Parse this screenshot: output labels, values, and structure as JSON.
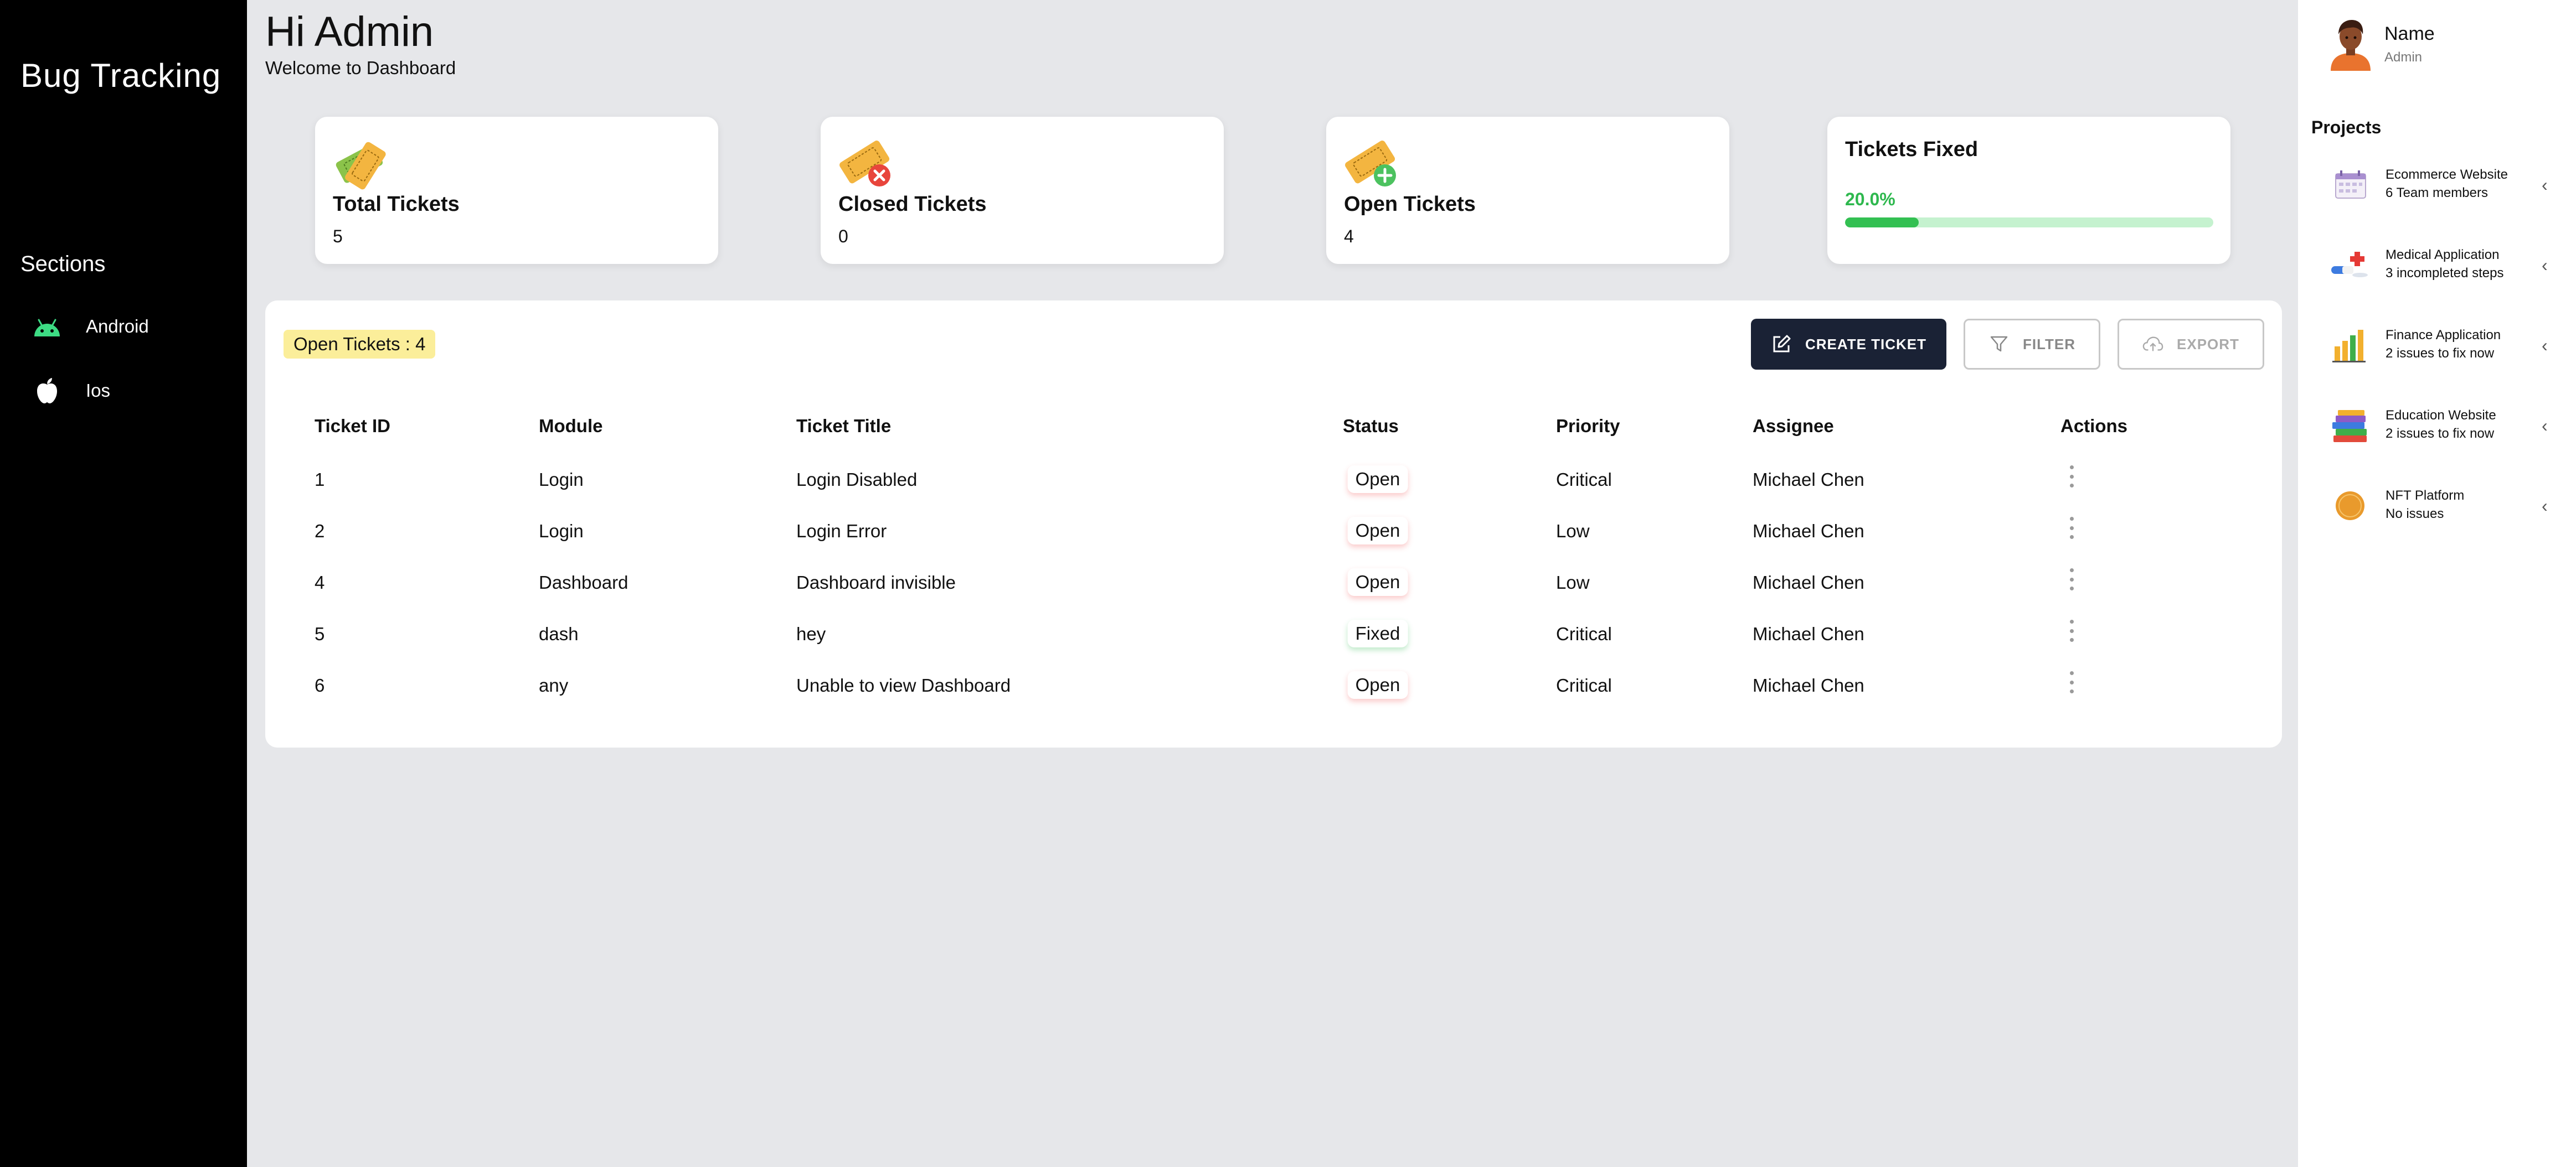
{
  "sidebar": {
    "brand": "Bug Tracking",
    "sections_heading": "Sections",
    "items": [
      {
        "label": "Android",
        "icon": "android-icon",
        "icon_color": "#3ddc84"
      },
      {
        "label": "Ios",
        "icon": "apple-icon",
        "icon_color": "#ffffff"
      }
    ]
  },
  "header": {
    "greeting": "Hi Admin",
    "subtitle": "Welcome to Dashboard"
  },
  "stats": {
    "total": {
      "label": "Total Tickets",
      "value": "5",
      "icon": "ticket-icon"
    },
    "closed": {
      "label": "Closed Tickets",
      "value": "0",
      "icon": "ticket-closed-icon"
    },
    "open": {
      "label": "Open Tickets",
      "value": "4",
      "icon": "ticket-open-icon"
    },
    "fixed": {
      "label": "Tickets Fixed",
      "percent_text": "20.0%",
      "progress": 0.2,
      "color": "#33c052"
    }
  },
  "tickets": {
    "badge": "Open Tickets : 4",
    "buttons": {
      "create": "CREATE TICKET",
      "filter": "FILTER",
      "export": "EXPORT"
    },
    "columns": [
      "Ticket ID",
      "Module",
      "Ticket Title",
      "Status",
      "Priority",
      "Assignee",
      "Actions"
    ],
    "rows": [
      {
        "id": "1",
        "module": "Login",
        "title": "Login Disabled",
        "status": "Open",
        "priority": "Critical",
        "assignee": "Michael Chen"
      },
      {
        "id": "2",
        "module": "Login",
        "title": "Login Error",
        "status": "Open",
        "priority": "Low",
        "assignee": "Michael Chen"
      },
      {
        "id": "4",
        "module": "Dashboard",
        "title": "Dashboard invisible",
        "status": "Open",
        "priority": "Low",
        "assignee": "Michael Chen"
      },
      {
        "id": "5",
        "module": "dash",
        "title": "hey",
        "status": "Fixed",
        "priority": "Critical",
        "assignee": "Michael Chen"
      },
      {
        "id": "6",
        "module": "any",
        "title": "Unable to view Dashboard",
        "status": "Open",
        "priority": "Critical",
        "assignee": "Michael Chen"
      }
    ],
    "status_colors": {
      "Open": "#f04646",
      "Fixed": "#3cbe5a"
    }
  },
  "profile": {
    "name": "Name",
    "role": "Admin"
  },
  "projects": {
    "heading": "Projects",
    "items": [
      {
        "name": "Ecommerce Website",
        "sub": "6 Team members",
        "icon": "calendar-icon"
      },
      {
        "name": "Medical Application",
        "sub": "3 incompleted steps",
        "icon": "medical-icon"
      },
      {
        "name": "Finance Application",
        "sub": "2 issues to fix now",
        "icon": "bar-chart-icon"
      },
      {
        "name": "Education Website",
        "sub": "2 issues to fix now",
        "icon": "books-icon"
      },
      {
        "name": "NFT Platform",
        "sub": "No issues",
        "icon": "nft-coin-icon"
      }
    ]
  }
}
